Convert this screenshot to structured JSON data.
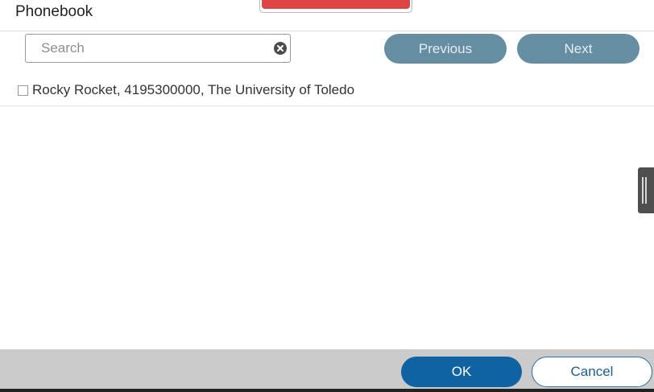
{
  "dialog": {
    "title": "Phonebook"
  },
  "search": {
    "placeholder": "Search",
    "value": ""
  },
  "pagination": {
    "previous_label": "Previous",
    "next_label": "Next"
  },
  "results": [
    {
      "checked": false,
      "text": "Rocky Rocket, 4195300000, The University of Toledo"
    }
  ],
  "footer": {
    "ok_label": "OK",
    "cancel_label": "Cancel"
  },
  "icons": {
    "clear": "clear-circle-x-icon",
    "checkbox": "checkbox-icon",
    "handle": "drag-handle-icon"
  },
  "colors": {
    "pill_button": "#668ea3",
    "primary_button": "#0f63a2",
    "footer_bg": "#cbcbcb",
    "top_tab_red": "#de4646"
  }
}
